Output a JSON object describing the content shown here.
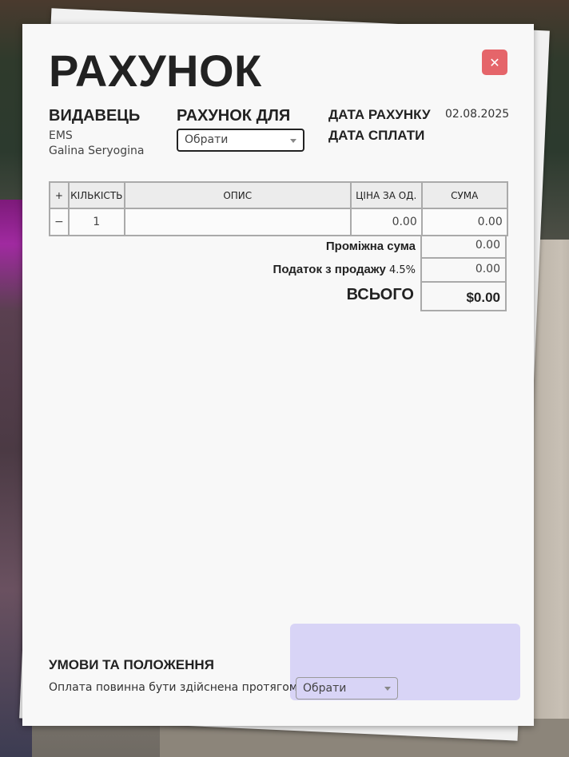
{
  "invoice": {
    "title": "РАХУНОК",
    "close_symbol": "✕",
    "issuer": {
      "label": "ВИДАВЕЦЬ",
      "lines": [
        "EMS",
        "Galina Seryogina"
      ]
    },
    "bill_to": {
      "label": "РАХУНОК ДЛЯ",
      "selected": "Обрати"
    },
    "dates": {
      "invoice_date_label": "ДАТА РАХУНКУ",
      "invoice_date_value": "02.08.2025",
      "due_date_label": "ДАТА СПЛАТИ"
    },
    "table": {
      "headers": [
        "+",
        "КІЛЬКІСТЬ",
        "ОПИС",
        "ЦІНА ЗА ОД.",
        "СУМА"
      ],
      "rows": [
        {
          "remove": "−",
          "qty": "1",
          "desc": "",
          "price": "0.00",
          "amount": "0.00"
        }
      ]
    },
    "totals": {
      "subtotal_label": "Проміжна сума",
      "subtotal_value": "0.00",
      "tax_label": "Податок з продажу",
      "tax_rate": "4.5%",
      "tax_value": "0.00",
      "total_label": "ВСЬОГО",
      "total_value": "$0.00"
    },
    "terms": {
      "label": "УМОВИ ТА ПОЛОЖЕННЯ",
      "text": "Оплата повинна бути здійснена протягом",
      "selected": "Обрати"
    }
  },
  "colors": {
    "close_button": "#e5656a",
    "terms_box": "#d8d4f6",
    "paper": "#f8f8f8"
  }
}
